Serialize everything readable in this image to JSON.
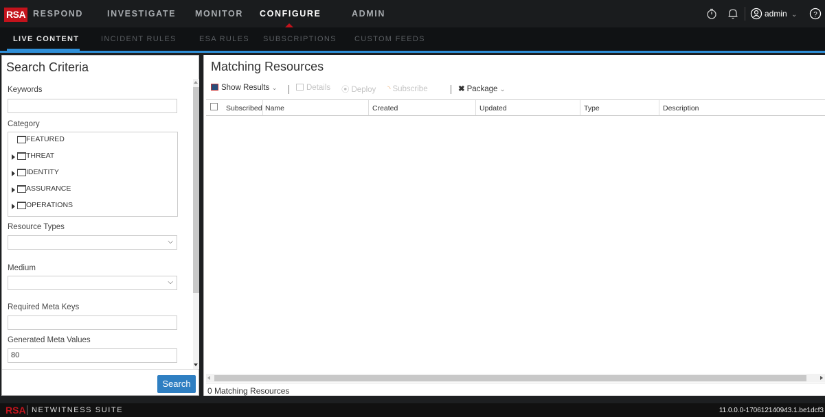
{
  "app": {
    "logo": "RSA",
    "nav": [
      "RESPOND",
      "INVESTIGATE",
      "MONITOR",
      "CONFIGURE",
      "ADMIN"
    ],
    "active_nav": "CONFIGURE",
    "user": "admin",
    "icons": [
      "timer-icon",
      "bell-icon",
      "user-icon",
      "help-icon"
    ]
  },
  "subnav": {
    "items": [
      "LIVE CONTENT",
      "INCIDENT RULES",
      "ESA RULES",
      "SUBSCRIPTIONS",
      "CUSTOM FEEDS"
    ],
    "active": "LIVE CONTENT"
  },
  "search": {
    "title": "Search Criteria",
    "keywords_label": "Keywords",
    "keywords_value": "",
    "category_label": "Category",
    "categories": [
      {
        "label": "FEATURED",
        "expandable": false
      },
      {
        "label": "THREAT",
        "expandable": true
      },
      {
        "label": "IDENTITY",
        "expandable": true
      },
      {
        "label": "ASSURANCE",
        "expandable": true
      },
      {
        "label": "OPERATIONS",
        "expandable": true
      }
    ],
    "resource_types_label": "Resource Types",
    "resource_types_value": "",
    "medium_label": "Medium",
    "medium_value": "",
    "required_meta_keys_label": "Required Meta Keys",
    "required_meta_keys_value": "",
    "generated_meta_values_label": "Generated Meta Values",
    "generated_meta_values_value": "80",
    "search_button": "Search"
  },
  "results": {
    "title": "Matching Resources",
    "toolbar": {
      "show_results": "Show Results",
      "details": "Details",
      "deploy": "Deploy",
      "subscribe": "Subscribe",
      "package": "Package"
    },
    "columns": [
      "Subscribed",
      "Name",
      "Created",
      "Updated",
      "Type",
      "Description"
    ],
    "rows": [],
    "status": "0 Matching Resources"
  },
  "footer": {
    "brand": "RSA",
    "product": "NETWITNESS SUITE",
    "version": "11.0.0.0-170612140943.1.be1dcf3"
  },
  "colors": {
    "brand_red": "#c3131c",
    "accent_blue": "#2f8fd8",
    "button_blue": "#2f7fc2",
    "topbar_bg": "#1a1c1e"
  }
}
